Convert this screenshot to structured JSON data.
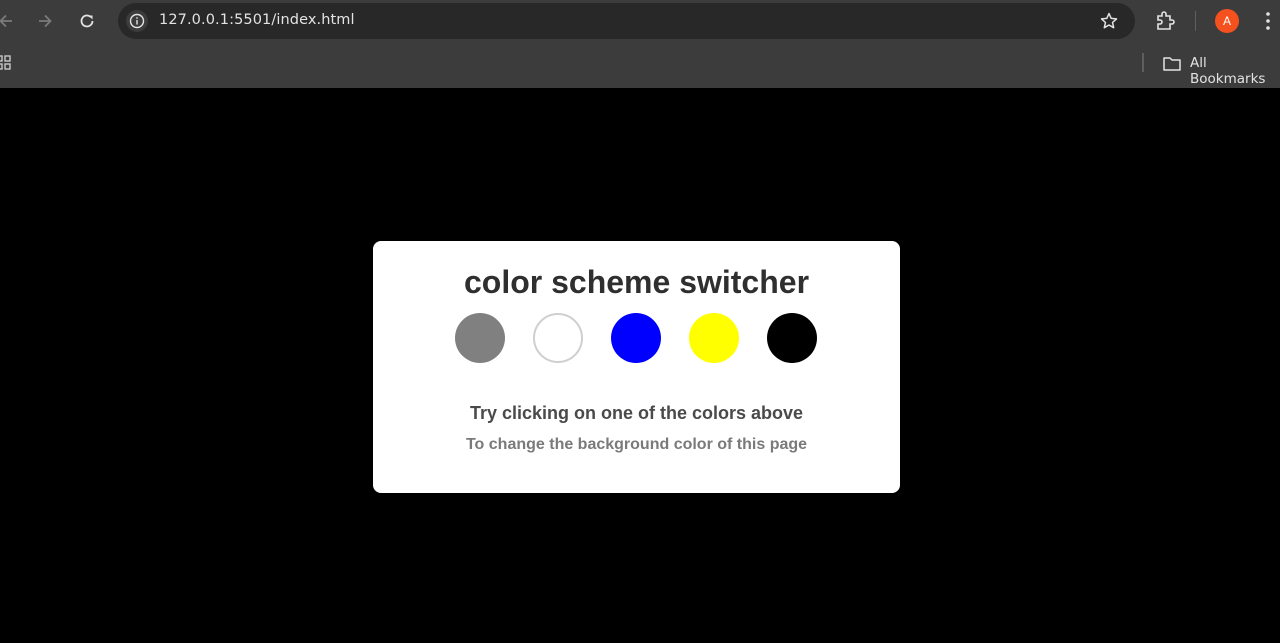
{
  "browser": {
    "url": "127.0.0.1:5501/index.html",
    "profile_initial": "A",
    "bookmarks_label": "All Bookmarks"
  },
  "page": {
    "title": "color scheme switcher",
    "hint": "Try clicking on one of the colors above",
    "subhint": "To change the background color of this page",
    "background": "#000000",
    "swatches": [
      {
        "name": "gray",
        "color": "#808080"
      },
      {
        "name": "white",
        "color": "#ffffff"
      },
      {
        "name": "blue",
        "color": "#0000ff"
      },
      {
        "name": "yellow",
        "color": "#ffff00"
      },
      {
        "name": "black",
        "color": "#000000"
      }
    ]
  },
  "icons": [
    "back-icon",
    "forward-icon",
    "reload-icon",
    "site-info-icon",
    "bookmark-star-icon",
    "extensions-icon",
    "menu-icon",
    "apps-icon",
    "folder-icon"
  ]
}
